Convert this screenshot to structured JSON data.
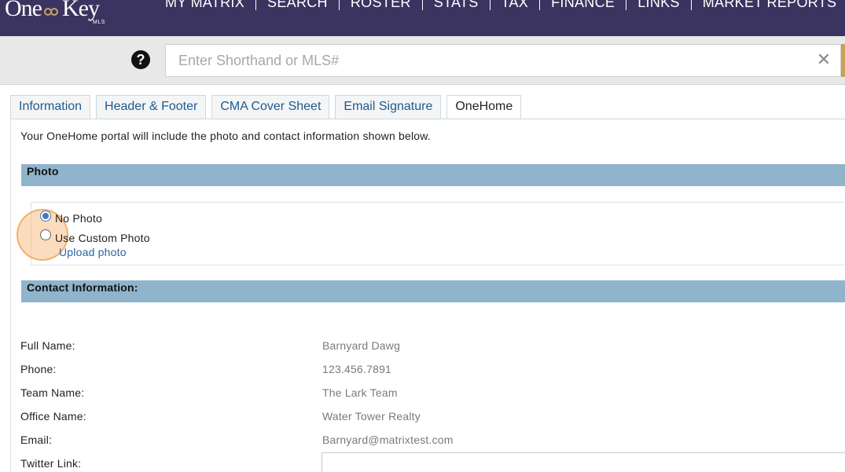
{
  "header": {
    "logo_text_left": "One",
    "logo_text_right": "Key",
    "logo_sub": "MLS",
    "nav": [
      "MY MATRIX",
      "SEARCH",
      "ROSTER",
      "STATS",
      "TAX",
      "FINANCE",
      "LINKS",
      "MARKET REPORTS"
    ]
  },
  "search": {
    "placeholder": "Enter Shorthand or MLS#",
    "value": "",
    "help_icon": "question-circle-icon",
    "clear_icon": "close-icon"
  },
  "tabs": [
    {
      "label": "Information",
      "active": false
    },
    {
      "label": "Header & Footer",
      "active": false
    },
    {
      "label": "CMA Cover Sheet",
      "active": false
    },
    {
      "label": "Email Signature",
      "active": false
    },
    {
      "label": "OneHome",
      "active": true
    }
  ],
  "intro_text": "Your OneHome portal will include the photo and contact information shown below.",
  "photo": {
    "header": "Photo",
    "options": [
      {
        "label": "No Photo",
        "selected": true
      },
      {
        "label": "Use Custom Photo",
        "selected": false
      }
    ],
    "upload_link": "Upload photo"
  },
  "contact": {
    "header": "Contact Information:",
    "fields": [
      {
        "label": "Full Name:",
        "value": "Barnyard Dawg"
      },
      {
        "label": "Phone:",
        "value": "123.456.7891"
      },
      {
        "label": "Team Name:",
        "value": "The Lark Team"
      },
      {
        "label": "Office Name:",
        "value": "Water Tower Realty"
      },
      {
        "label": "Email:",
        "value": "Barnyard@matrixtest.com"
      },
      {
        "label": "Twitter Link:",
        "value": ""
      }
    ]
  },
  "colors": {
    "topbar": "#3b3360",
    "section_header": "#8fb4cc",
    "link": "#1f5a8e",
    "accent": "#c9a25a"
  }
}
